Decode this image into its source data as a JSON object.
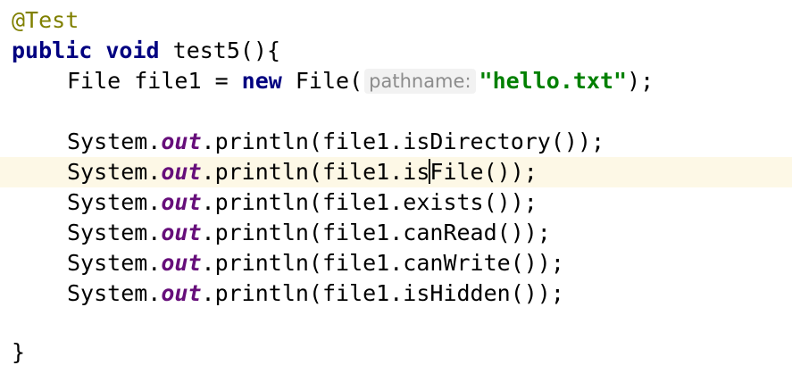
{
  "editor": {
    "annotation": "@Test",
    "method": {
      "modifier": "public",
      "return_type": "void",
      "signature": " test5(){"
    },
    "file_decl": {
      "type_and_var": "File file1 = ",
      "new_keyword": "new",
      "ctor_open": " File(",
      "param_hint": "pathname:",
      "string_literal": "\"hello.txt\"",
      "close": ");"
    },
    "println_prefix": "System.",
    "out_field": "out",
    "println_calls": [
      ".println(file1.isDirectory());",
      ".println(file1.isFile());",
      ".println(file1.exists());",
      ".println(file1.canRead());",
      ".println(file1.canWrite());",
      ".println(file1.isHidden());"
    ],
    "caret_line": {
      "before_caret": ".println(file1.is",
      "after_caret": "File());"
    },
    "closing_brace": "}"
  },
  "colors": {
    "annotation": "#808000",
    "keyword": "#000080",
    "string": "#008000",
    "static_field": "#660e7a",
    "current_line_bg": "#fdf8e6",
    "hint_text": "#8c8c8c"
  }
}
